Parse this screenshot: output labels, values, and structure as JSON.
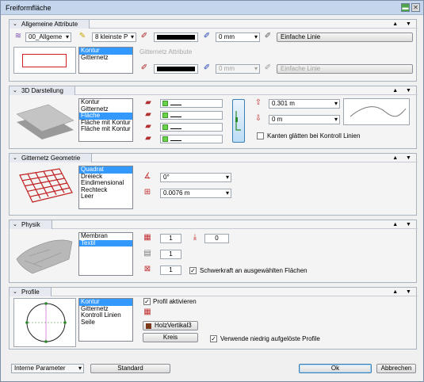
{
  "window": {
    "title": "Freiformfläche",
    "minimize": "▬",
    "close": "✕"
  },
  "sec_controls": "▲ ▼",
  "chevron": "⌄",
  "allg": {
    "title": "Allgemeine Attribute",
    "layer": "00_Allgeme",
    "pen_size": "8 kleinste P",
    "pen_width": "0 mm",
    "line_type": "Einfache Linie",
    "list": [
      "Kontur",
      "Gitternetz"
    ],
    "grid_label": "Gitternetz Attribute",
    "grid_width": "0 mm",
    "grid_line": "Einfache Linie"
  },
  "darst": {
    "title": "3D Darstellung",
    "list": [
      "Kontur",
      "Gitternetz",
      "Fläche",
      "Fläche mit Kontur",
      "Fläche mit Kontur und"
    ],
    "selected": 2,
    "offset1": "0.301 m",
    "offset2": "0 m",
    "smooth_label": "Kanten glätten bei Kontroll Linien"
  },
  "gitter": {
    "title": "Gitternetz Geometrie",
    "list": [
      "Quadrat",
      "Dreieck",
      "Eindimensional",
      "Rechteck",
      "Leer"
    ],
    "angle": "0°",
    "spacing": "0.0076 m"
  },
  "physik": {
    "title": "Physik",
    "list": [
      "Membran",
      "Textil"
    ],
    "v1": "1",
    "v2": "0",
    "v3": "1",
    "v4": "1",
    "gravity_label": "Schwerkraft an ausgewählten Flächen"
  },
  "profile": {
    "title": "Profile",
    "list": [
      "Kontur",
      "Gitternetz",
      "Kontroll Linien",
      "Seile"
    ],
    "activate_label": "Profil aktivieren",
    "profile_name": "HolzVertikal3",
    "shape_button": "Kreis",
    "lowres_label": "Verwende niedrig aufgelöste Profile"
  },
  "footer": {
    "params": "Interne Parameter",
    "standard": "Standard",
    "ok": "Ok",
    "cancel": "Abbrechen"
  }
}
